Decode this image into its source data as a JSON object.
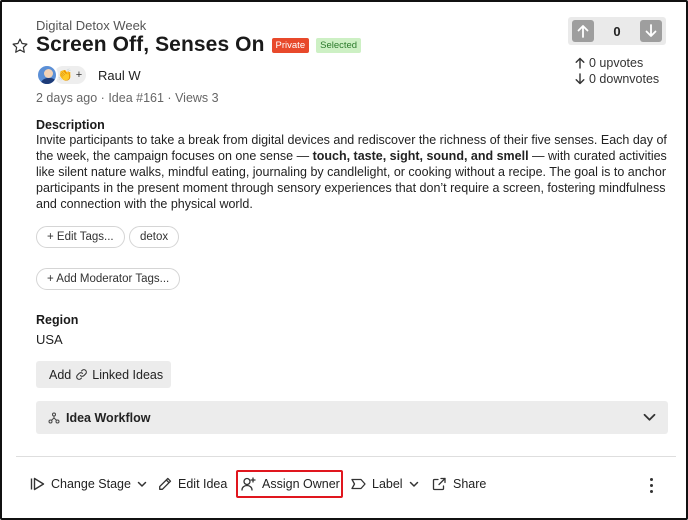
{
  "idea": {
    "category": "Digital Detox Week",
    "title": "Screen Off, Senses On",
    "badges": {
      "private": "Private",
      "selected": "Selected"
    },
    "author": "Raul W",
    "meta": {
      "time": "2 days ago",
      "sep1": "·",
      "idea_no": "Idea #161",
      "sep2": "·",
      "views": "Views 3"
    }
  },
  "votes": {
    "count": "0",
    "upvotes": "0 upvotes",
    "downvotes": "0 downvotes"
  },
  "description": {
    "label": "Description",
    "text_before": "Invite participants to take a break from digital devices and rediscover the richness of their five senses. Each day of the week, the campaign focuses on one sense — ",
    "text_bold": "touch, taste, sight, sound, and smell",
    "text_after": " — with curated activities like silent nature walks, mindful eating, journaling by candlelight, or cooking without a recipe. The goal is to anchor participants in the present moment through sensory experiences that don’t require a screen, fostering mindfulness and connection with the physical world."
  },
  "tags": {
    "edit_tags": "+ Edit Tags...",
    "items": [
      "detox"
    ],
    "moderator_tags": "+ Add Moderator Tags..."
  },
  "region": {
    "label": "Region",
    "value": "USA"
  },
  "linked_ideas": {
    "add": "Add",
    "label": "Linked Ideas"
  },
  "workflow": {
    "label": "Idea Workflow"
  },
  "toolbar": {
    "change_stage": "Change Stage",
    "edit_idea": "Edit Idea",
    "assign_owner": "Assign Owner",
    "label": "Label",
    "share": "Share"
  },
  "icons": {
    "star": "star-icon",
    "clap": "👏",
    "plus": "+"
  },
  "colors": {
    "private_badge": "#e8492b",
    "selected_badge_bg": "#cdf0c4",
    "highlight": "#e0161e"
  }
}
